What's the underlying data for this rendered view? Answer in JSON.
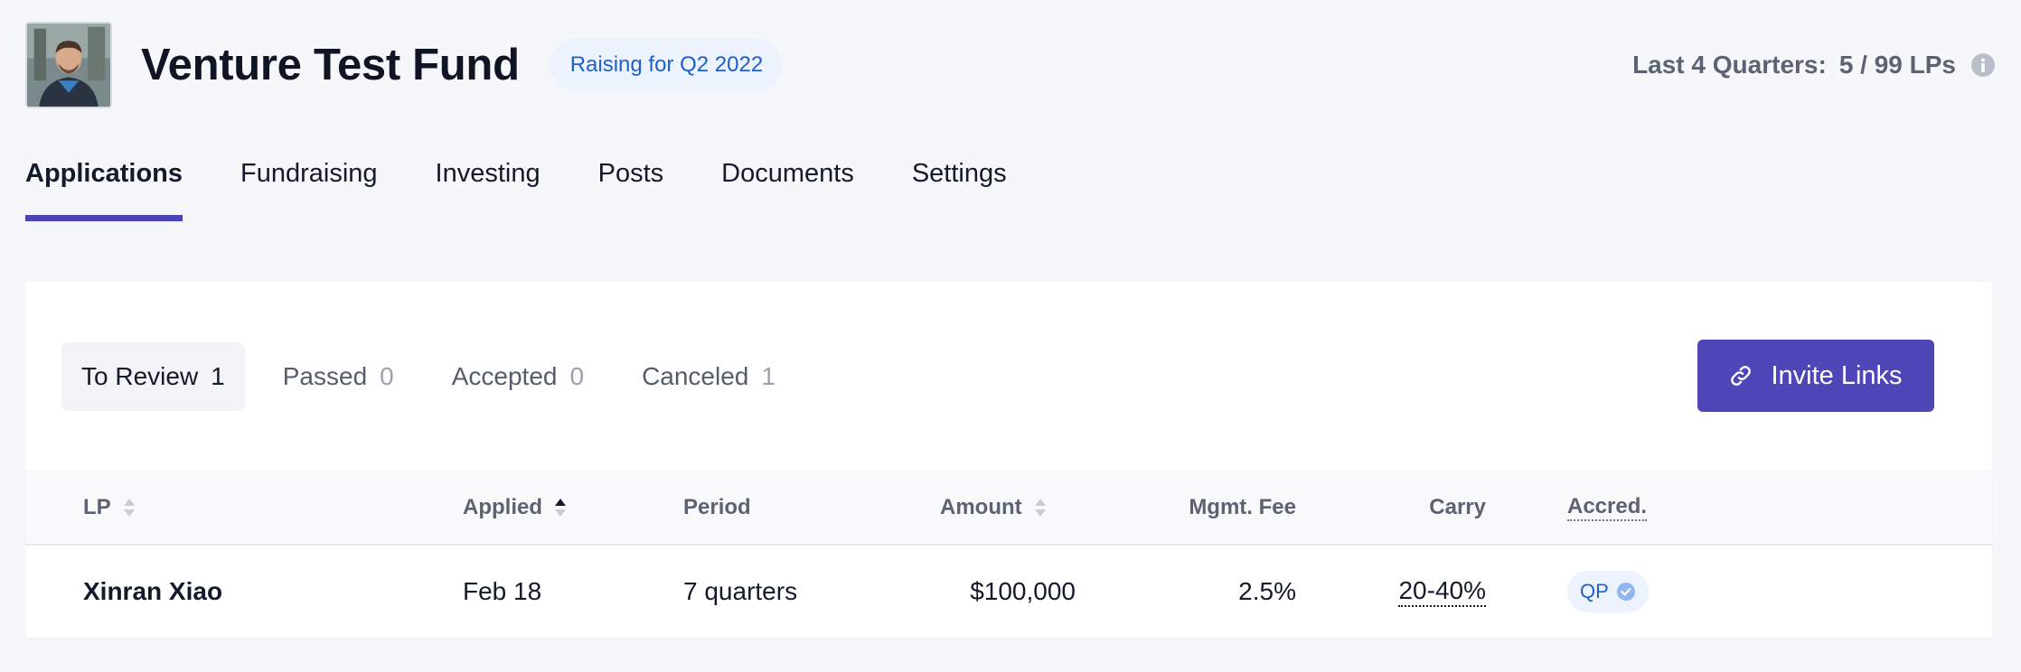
{
  "header": {
    "fund_name": "Venture Test Fund",
    "raising_badge": "Raising for Q2 2022",
    "quarters_label": "Last 4 Quarters:",
    "quarters_value": "5 / 99 LPs"
  },
  "top_tabs": [
    {
      "label": "Applications",
      "active": true
    },
    {
      "label": "Fundraising"
    },
    {
      "label": "Investing"
    },
    {
      "label": "Posts"
    },
    {
      "label": "Documents"
    },
    {
      "label": "Settings"
    }
  ],
  "status_tabs": [
    {
      "label": "To Review",
      "count": "1",
      "active": true
    },
    {
      "label": "Passed",
      "count": "0"
    },
    {
      "label": "Accepted",
      "count": "0"
    },
    {
      "label": "Canceled",
      "count": "1"
    }
  ],
  "invite_button": "Invite Links",
  "table": {
    "columns": {
      "lp": "LP",
      "applied": "Applied",
      "period": "Period",
      "amount": "Amount",
      "mgmt_fee": "Mgmt. Fee",
      "carry": "Carry",
      "accred": "Accred."
    },
    "rows": [
      {
        "lp": "Xinran Xiao",
        "applied": "Feb 18",
        "period": "7 quarters",
        "amount": "$100,000",
        "mgmt_fee": "2.5%",
        "carry": "20-40%",
        "accred": "QP"
      }
    ]
  },
  "colors": {
    "accent": "#4f47b8",
    "badge_bg": "#edf3fd",
    "badge_text": "#1e5fc9"
  },
  "icons": {
    "info": "info-icon",
    "link": "link-icon",
    "sort": "sort-icon",
    "check": "check-circle-icon"
  }
}
